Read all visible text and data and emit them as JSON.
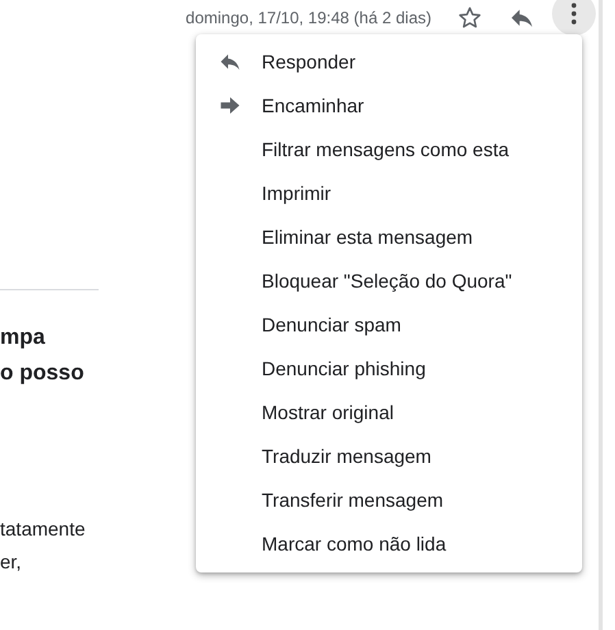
{
  "header": {
    "date": "domingo, 17/10, 19:48 (há 2 dias)",
    "more_button_hovered": true
  },
  "message": {
    "heading_lines": [
      "mpa",
      "o posso"
    ],
    "body_lines": [
      "tatamente",
      "er,"
    ]
  },
  "menu": {
    "items": [
      {
        "label": "Responder",
        "kind": "reply"
      },
      {
        "label": "Encaminhar",
        "kind": "forward"
      },
      {
        "label": "Filtrar mensagens como esta",
        "kind": "plain"
      },
      {
        "label": "Imprimir",
        "kind": "plain"
      },
      {
        "label": "Eliminar esta mensagem",
        "kind": "plain"
      },
      {
        "label": "Bloquear \"Seleção do Quora\"",
        "kind": "plain"
      },
      {
        "label": "Denunciar spam",
        "kind": "plain"
      },
      {
        "label": "Denunciar phishing",
        "kind": "plain"
      },
      {
        "label": "Mostrar original",
        "kind": "plain"
      },
      {
        "label": "Traduzir mensagem",
        "kind": "plain"
      },
      {
        "label": "Transferir mensagem",
        "kind": "plain"
      },
      {
        "label": "Marcar como não lida",
        "kind": "plain"
      }
    ]
  }
}
